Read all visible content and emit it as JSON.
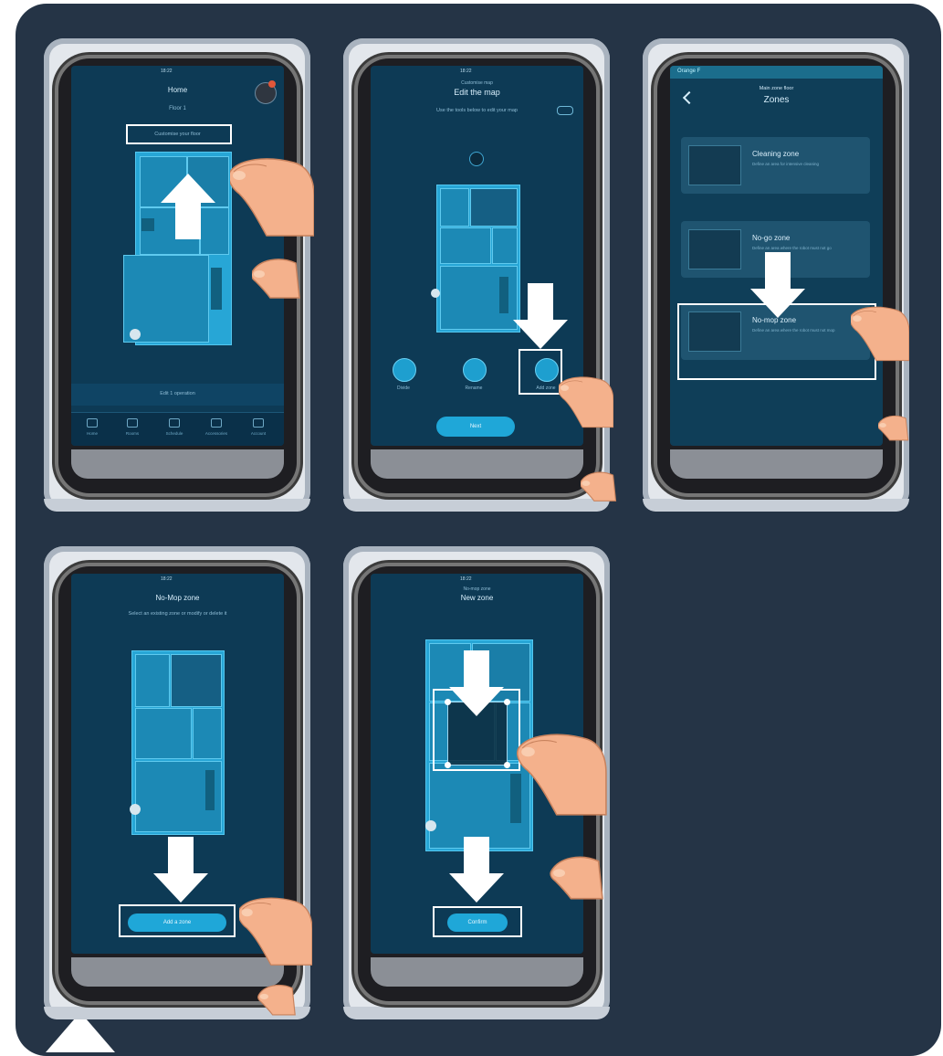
{
  "screens": [
    {
      "id": "step1",
      "status_time": "18:22",
      "title": "Home",
      "floor_label": "Floor 1",
      "highlighted_row": "Customise your floor",
      "bottom_button": "Edit 1 operation",
      "tabs": [
        "Home",
        "Rooms",
        "Schedule",
        "Accessories",
        "Account"
      ]
    },
    {
      "id": "step2",
      "status_time": "18:22",
      "subtitle": "Customise map",
      "title": "Edit the map",
      "hint": "Use the tools below to edit your map",
      "buttons": [
        "Divide",
        "Rename",
        "Add zone"
      ],
      "done_button": "Next"
    },
    {
      "id": "step3",
      "status_carrier": "Orange F",
      "subtitle": "Main zone floor",
      "title": "Zones",
      "zones": [
        {
          "title": "Cleaning zone",
          "desc": "Define an area for intensive cleaning"
        },
        {
          "title": "No-go zone",
          "desc": "Define an area where the robot must not go"
        },
        {
          "title": "No-mop zone",
          "desc": "Define an area where the robot must not mop"
        }
      ]
    },
    {
      "id": "step4",
      "status_time": "18:22",
      "title": "No-Mop zone",
      "hint": "Select an existing zone or modify or delete it",
      "add_button": "Add a zone"
    },
    {
      "id": "step5",
      "status_time": "18:22",
      "subtitle": "No-mop zone",
      "title": "New zone",
      "confirm_button": "Confirm"
    }
  ],
  "colors": {
    "background": "#253446",
    "screen": "#0d3a55",
    "map": "#27a6d6",
    "highlight": "#ffffff"
  }
}
